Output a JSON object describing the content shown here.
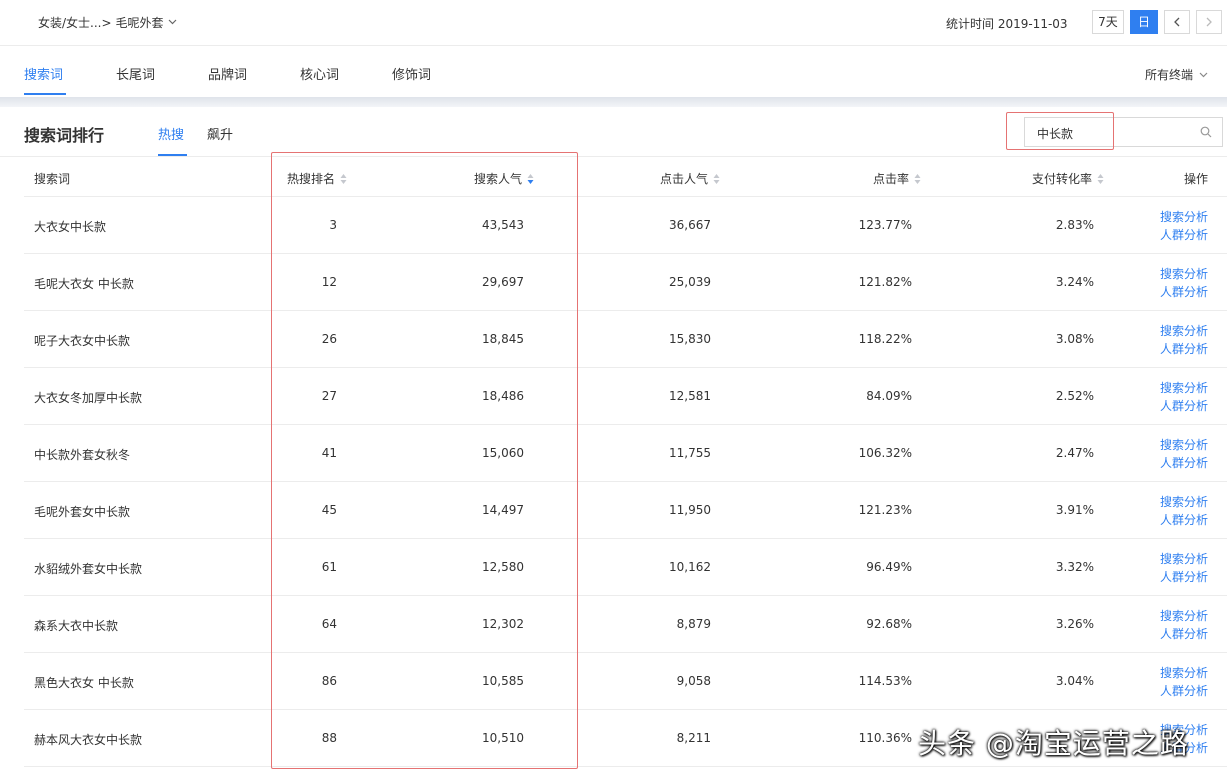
{
  "breadcrumb": {
    "category": "女装/女士...>",
    "subcategory": "毛呢外套"
  },
  "stat": {
    "label": "统计时间 2019-11-03"
  },
  "period": {
    "seven_days": "7天",
    "day": "日",
    "prev": "<",
    "next": ">"
  },
  "tabs": [
    {
      "label": "搜索词"
    },
    {
      "label": "长尾词"
    },
    {
      "label": "品牌词"
    },
    {
      "label": "核心词"
    },
    {
      "label": "修饰词"
    }
  ],
  "terminal": {
    "label": "所有终端"
  },
  "ranking": {
    "title": "搜索词排行",
    "subtabs": [
      {
        "label": "热搜"
      },
      {
        "label": "飙升"
      }
    ]
  },
  "search": {
    "value": "中长款"
  },
  "columns": {
    "keyword": "搜索词",
    "rank": "热搜排名",
    "search_pop": "搜索人气",
    "click_pop": "点击人气",
    "ctr": "点击率",
    "cvr": "支付转化率",
    "ops": "操作"
  },
  "rows": [
    {
      "keyword": "大衣女中长款",
      "rank": "3",
      "search_pop": "43,543",
      "click_pop": "36,667",
      "ctr": "123.77%",
      "cvr": "2.83%",
      "op1": "搜索分析",
      "op2": "人群分析"
    },
    {
      "keyword": "毛呢大衣女 中长款",
      "rank": "12",
      "search_pop": "29,697",
      "click_pop": "25,039",
      "ctr": "121.82%",
      "cvr": "3.24%",
      "op1": "搜索分析",
      "op2": "人群分析"
    },
    {
      "keyword": "呢子大衣女中长款",
      "rank": "26",
      "search_pop": "18,845",
      "click_pop": "15,830",
      "ctr": "118.22%",
      "cvr": "3.08%",
      "op1": "搜索分析",
      "op2": "人群分析"
    },
    {
      "keyword": "大衣女冬加厚中长款",
      "rank": "27",
      "search_pop": "18,486",
      "click_pop": "12,581",
      "ctr": "84.09%",
      "cvr": "2.52%",
      "op1": "搜索分析",
      "op2": "人群分析"
    },
    {
      "keyword": "中长款外套女秋冬",
      "rank": "41",
      "search_pop": "15,060",
      "click_pop": "11,755",
      "ctr": "106.32%",
      "cvr": "2.47%",
      "op1": "搜索分析",
      "op2": "人群分析"
    },
    {
      "keyword": "毛呢外套女中长款",
      "rank": "45",
      "search_pop": "14,497",
      "click_pop": "11,950",
      "ctr": "121.23%",
      "cvr": "3.91%",
      "op1": "搜索分析",
      "op2": "人群分析"
    },
    {
      "keyword": "水貂绒外套女中长款",
      "rank": "61",
      "search_pop": "12,580",
      "click_pop": "10,162",
      "ctr": "96.49%",
      "cvr": "3.32%",
      "op1": "搜索分析",
      "op2": "人群分析"
    },
    {
      "keyword": "森系大衣中长款",
      "rank": "64",
      "search_pop": "12,302",
      "click_pop": "8,879",
      "ctr": "92.68%",
      "cvr": "3.26%",
      "op1": "搜索分析",
      "op2": "人群分析"
    },
    {
      "keyword": "黑色大衣女 中长款",
      "rank": "86",
      "search_pop": "10,585",
      "click_pop": "9,058",
      "ctr": "114.53%",
      "cvr": "3.04%",
      "op1": "搜索分析",
      "op2": "人群分析"
    },
    {
      "keyword": "赫本风大衣女中长款",
      "rank": "88",
      "search_pop": "10,510",
      "click_pop": "8,211",
      "ctr": "110.36%",
      "cvr": "",
      "op1": "搜索分析",
      "op2": "人群分析"
    }
  ],
  "watermark": {
    "text": "头条 @淘宝运营之路"
  },
  "colors": {
    "accent": "#2f7ff0",
    "highlight": "#e57373"
  }
}
